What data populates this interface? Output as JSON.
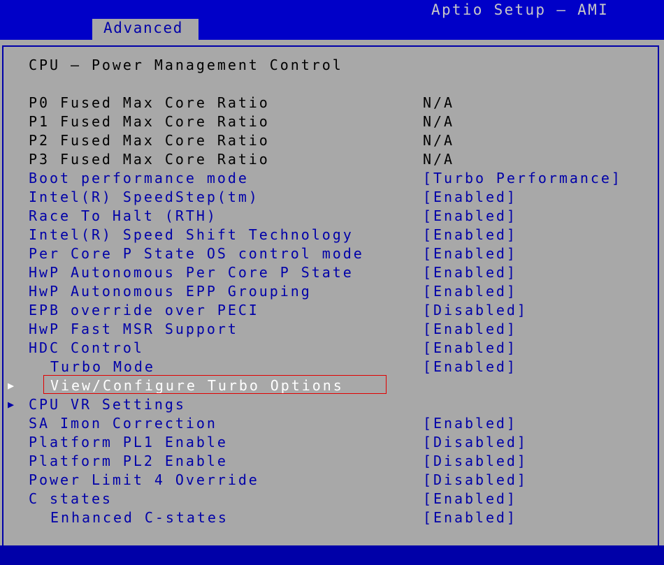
{
  "header": {
    "app_title": "Aptio Setup – AMI",
    "active_tab": "Advanced"
  },
  "page": {
    "title": "CPU – Power Management Control"
  },
  "info_rows": [
    {
      "label": "P0 Fused Max Core Ratio",
      "value": "N/A"
    },
    {
      "label": "P1 Fused Max Core Ratio",
      "value": "N/A"
    },
    {
      "label": "P2 Fused Max Core Ratio",
      "value": "N/A"
    },
    {
      "label": "P3 Fused Max Core Ratio",
      "value": "N/A"
    }
  ],
  "settings_a": [
    {
      "label": "Boot performance mode",
      "value": "[Turbo Performance]"
    },
    {
      "label": "Intel(R) SpeedStep(tm)",
      "value": "[Enabled]"
    },
    {
      "label": "Race To Halt (RTH)",
      "value": "[Enabled]"
    },
    {
      "label": "Intel(R) Speed Shift Technology",
      "value": "[Enabled]"
    },
    {
      "label": "Per Core P State OS control mode",
      "value": "[Enabled]"
    },
    {
      "label": "HwP Autonomous Per Core P State",
      "value": "[Enabled]"
    },
    {
      "label": "HwP Autonomous EPP Grouping",
      "value": "[Enabled]"
    },
    {
      "label": "EPB override over PECI",
      "value": "[Disabled]"
    },
    {
      "label": "HwP Fast MSR Support",
      "value": "[Enabled]"
    },
    {
      "label": "HDC Control",
      "value": "[Enabled]"
    },
    {
      "label": "Turbo Mode",
      "value": "[Enabled]"
    }
  ],
  "submenus": [
    {
      "label": "View/Configure Turbo Options",
      "arrow": "▶",
      "selected": true
    },
    {
      "label": "CPU VR Settings",
      "arrow": "▶",
      "selected": false
    }
  ],
  "settings_b": [
    {
      "label": "SA Imon Correction",
      "value": "[Enabled]"
    },
    {
      "label": "Platform PL1 Enable",
      "value": "[Disabled]"
    },
    {
      "label": "Platform PL2 Enable",
      "value": "[Disabled]"
    },
    {
      "label": "Power Limit 4 Override",
      "value": "[Disabled]"
    },
    {
      "label": "C states",
      "value": "[Enabled]"
    },
    {
      "label": "Enhanced C-states",
      "value": "[Enabled]"
    }
  ],
  "colors": {
    "header_blue": "#0000c8",
    "panel_gray": "#a8a8a8",
    "setting_blue": "#0000a8",
    "selected_white": "#ffffff",
    "highlight_red": "#e00000"
  }
}
